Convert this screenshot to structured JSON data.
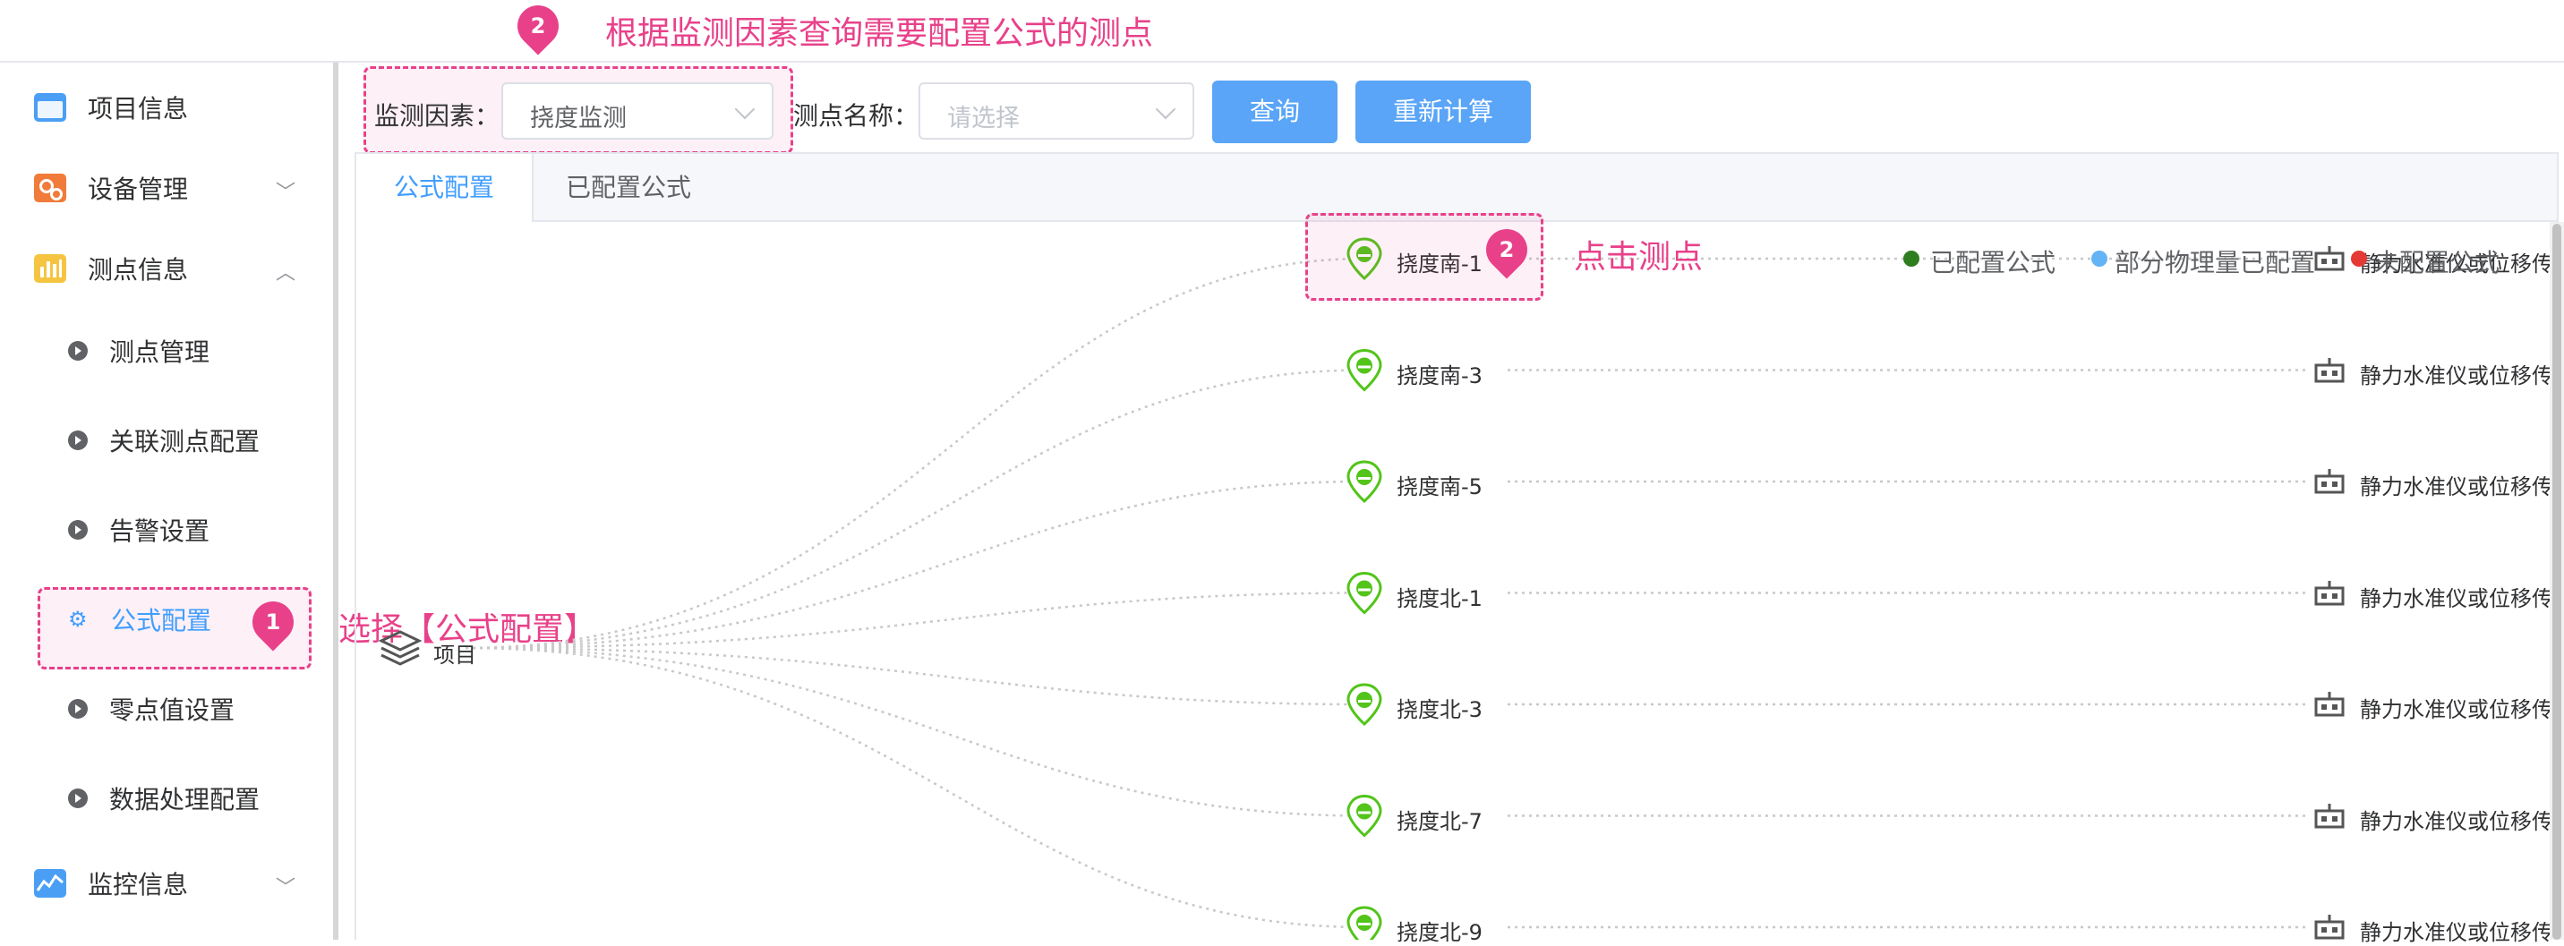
{
  "annotations": {
    "top_step": "2",
    "top_text": "根据监测因素查询需要配置公式的测点",
    "sidebar_step": "1",
    "sidebar_text": "选择【公式配置】",
    "node_step": "2",
    "node_text": "点击测点"
  },
  "sidebar": {
    "items": [
      {
        "label": "项目信息",
        "icon": "folder-icon"
      },
      {
        "label": "设备管理",
        "icon": "device-icon"
      },
      {
        "label": "测点信息",
        "icon": "chart-bars-icon"
      },
      {
        "label": "测点管理"
      },
      {
        "label": "关联测点配置"
      },
      {
        "label": "告警设置"
      },
      {
        "label": "公式配置",
        "icon": "gear-icon",
        "active": true
      },
      {
        "label": "零点值设置"
      },
      {
        "label": "数据处理配置"
      },
      {
        "label": "监控信息",
        "icon": "monitor-icon"
      }
    ]
  },
  "toolbar": {
    "factor_label": "监测因素：",
    "factor_value": "挠度监测",
    "point_label": "测点名称：",
    "point_placeholder": "请选择",
    "query_button": "查询",
    "recalc_button": "重新计算"
  },
  "tabs": [
    {
      "label": "公式配置",
      "active": true
    },
    {
      "label": "已配置公式",
      "active": false
    }
  ],
  "legend": [
    {
      "label": "已配置公式",
      "color": "#2e7d1f"
    },
    {
      "label": "部分物理量已配置",
      "color": "#63b3f5"
    },
    {
      "label": "未配置公式",
      "color": "#e53935"
    }
  ],
  "tree": {
    "root_label": "项目",
    "nodes": [
      {
        "label": "挠度南-1",
        "device": "静力水准仪或位移传"
      },
      {
        "label": "挠度南-3",
        "device": "静力水准仪或位移传"
      },
      {
        "label": "挠度南-5",
        "device": "静力水准仪或位移传"
      },
      {
        "label": "挠度北-1",
        "device": "静力水准仪或位移传"
      },
      {
        "label": "挠度北-3",
        "device": "静力水准仪或位移传"
      },
      {
        "label": "挠度北-7",
        "device": "静力水准仪或位移传"
      },
      {
        "label": "挠度北-9",
        "device": "静力水准仪或位移传"
      }
    ]
  },
  "colors": {
    "accent": "#409eff",
    "button": "#5aa5f7",
    "annotation": "#e8418a",
    "node_green": "#52c41a"
  }
}
